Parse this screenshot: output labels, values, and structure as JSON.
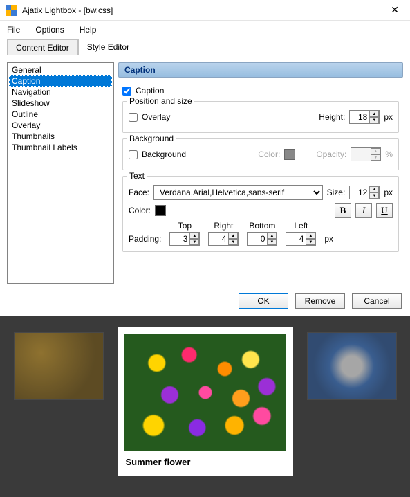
{
  "window": {
    "title": "Ajatix Lightbox - [bw.css]"
  },
  "menu": {
    "file": "File",
    "options": "Options",
    "help": "Help"
  },
  "tabs": {
    "content": "Content Editor",
    "style": "Style Editor"
  },
  "sidebar": {
    "items": [
      "General",
      "Caption",
      "Navigation",
      "Slideshow",
      "Outline",
      "Overlay",
      "Thumbnails",
      "Thumbnail Labels"
    ],
    "selected": 1
  },
  "panel": {
    "header": "Caption",
    "caption_checkbox": "Caption",
    "pos_size": {
      "legend": "Position and size",
      "overlay": "Overlay",
      "height_label": "Height:",
      "height_value": "18",
      "px": "px"
    },
    "background": {
      "legend": "Background",
      "checkbox": "Background",
      "color_label": "Color:",
      "opacity_label": "Opacity:",
      "opacity_value": "",
      "pct": "%"
    },
    "text": {
      "legend": "Text",
      "face_label": "Face:",
      "face_value": "Verdana,Arial,Helvetica,sans-serif",
      "size_label": "Size:",
      "size_value": "12",
      "px": "px",
      "color_label": "Color:",
      "bold": "B",
      "italic": "I",
      "underline": "U",
      "padding_label": "Padding:",
      "top": "Top",
      "right": "Right",
      "bottom": "Bottom",
      "left": "Left",
      "pad_top": "3",
      "pad_right": "4",
      "pad_bottom": "0",
      "pad_left": "4"
    }
  },
  "buttons": {
    "ok": "OK",
    "remove": "Remove",
    "cancel": "Cancel"
  },
  "preview": {
    "caption": "Summer flower"
  }
}
